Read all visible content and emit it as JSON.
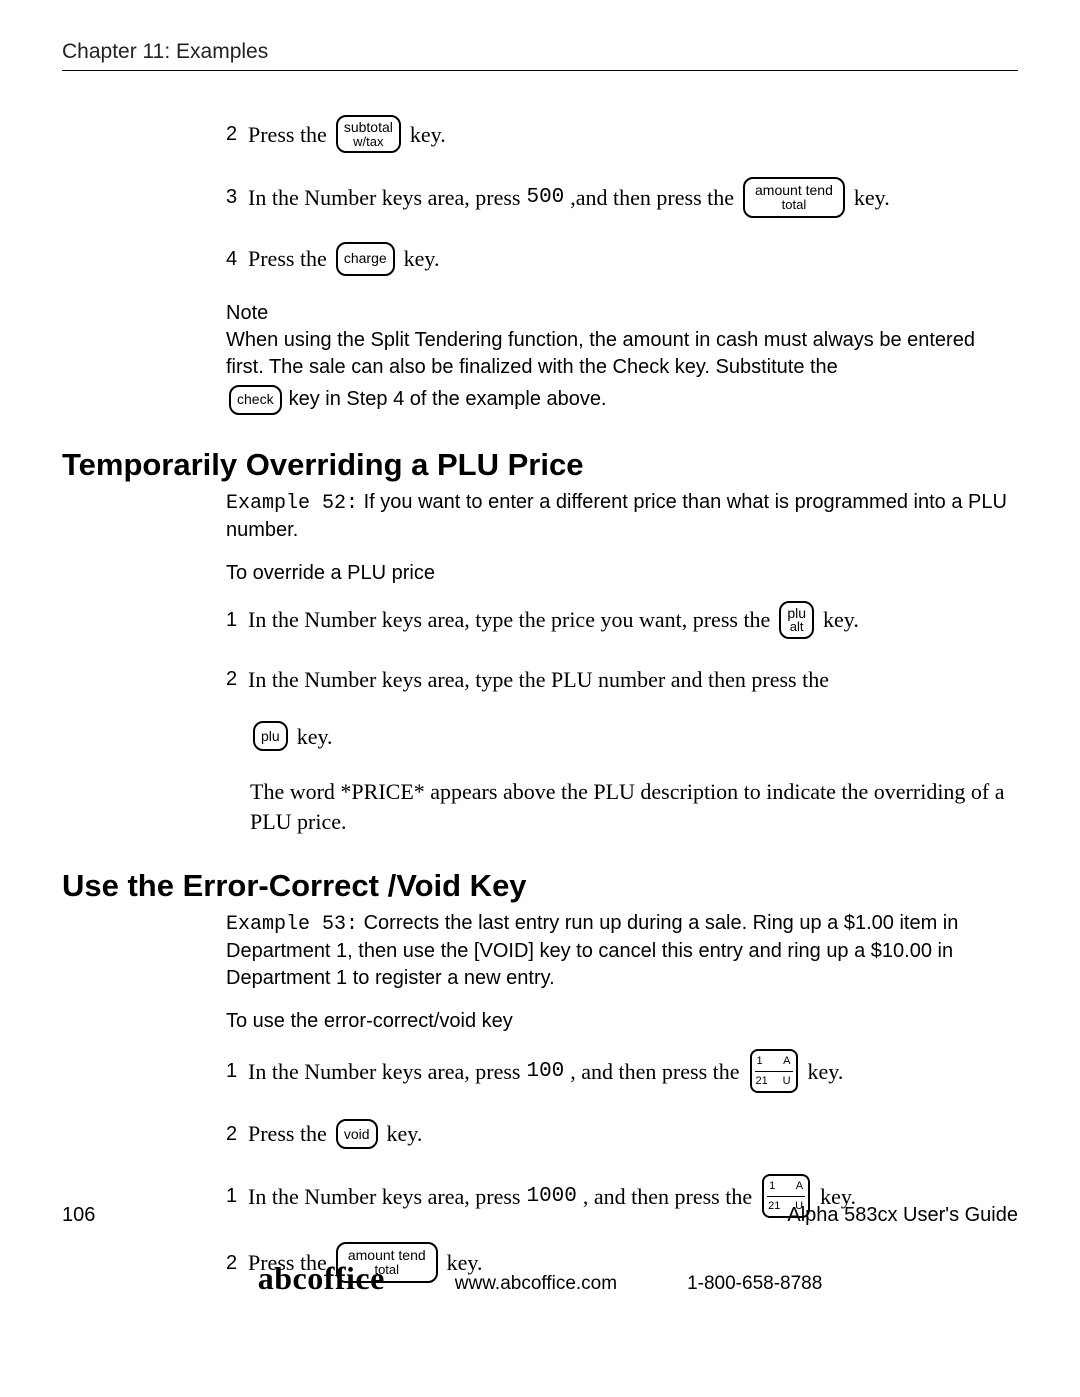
{
  "header": {
    "chapter": "Chapter 11:  Examples"
  },
  "top_steps": [
    {
      "num": "2",
      "parts": [
        {
          "t": "serif",
          "v": "Press the "
        },
        {
          "t": "key2",
          "l1": "subtotal",
          "l2": "w/tax"
        },
        {
          "t": "serif",
          "v": " key."
        }
      ]
    },
    {
      "num": "3",
      "parts": [
        {
          "t": "serif",
          "v": "In the Number keys area, press "
        },
        {
          "t": "mono",
          "v": "500"
        },
        {
          "t": "serif",
          "v": ",and then press the "
        },
        {
          "t": "keyw",
          "l1": "amount tend",
          "l2": "total"
        },
        {
          "t": "serif",
          "v": " key."
        }
      ]
    },
    {
      "num": "4",
      "parts": [
        {
          "t": "serif",
          "v": "Press the "
        },
        {
          "t": "key1",
          "l1": "charge"
        },
        {
          "t": "serif",
          "v": " key."
        }
      ]
    }
  ],
  "note": {
    "label": "Note",
    "line1": "When using the Split Tendering function, the amount in cash must always be entered first. The sale can also be finalized with the Check key. Substitute the ",
    "key": "check",
    "line2": " key in Step 4 of the example above."
  },
  "section1": {
    "heading": "Temporarily Overriding a PLU Price",
    "example_label": "Example 52:",
    "example_text": "If you want to enter a different price than what is programmed into a PLU number.",
    "subhead": "To override a PLU price",
    "steps": [
      {
        "num": "1",
        "parts": [
          {
            "t": "serif",
            "v": "In the Number keys area, type the price you want, press the "
          },
          {
            "t": "key2s",
            "l1": "plu",
            "l2": "alt"
          },
          {
            "t": "serif",
            "v": " key."
          }
        ]
      },
      {
        "num": "2",
        "parts": [
          {
            "t": "serif",
            "v": "In the Number keys area, type the PLU number and then press the"
          }
        ]
      }
    ],
    "step2_line2": {
      "parts": [
        {
          "t": "key1s",
          "l1": "plu"
        },
        {
          "t": "serif",
          "v": " key."
        }
      ]
    },
    "trailing": "The word *PRICE* appears above the PLU description to indicate the overriding of a PLU price."
  },
  "section2": {
    "heading": "Use the Error-Correct /Void Key",
    "example_label": "Example 53:",
    "example_text": "Corrects the last entry run up during a sale. Ring up a $1.00 item in Department 1, then use the [VOID] key to cancel this entry and ring up a $10.00 in Department 1 to register a new entry.",
    "subhead": "To use the error-correct/void key",
    "steps": [
      {
        "num": "1",
        "parts": [
          {
            "t": "serif",
            "v": "In the Number keys area, press "
          },
          {
            "t": "mono",
            "v": "100"
          },
          {
            "t": "serif",
            "v": ", and then press the "
          },
          {
            "t": "dept",
            "tl": "1",
            "tr": "A",
            "bl": "21",
            "br": "U"
          },
          {
            "t": "serif",
            "v": " key."
          }
        ]
      },
      {
        "num": "2",
        "parts": [
          {
            "t": "serif",
            "v": "Press the "
          },
          {
            "t": "key1s",
            "l1": "void"
          },
          {
            "t": "serif",
            "v": " key."
          }
        ]
      },
      {
        "num": "1",
        "parts": [
          {
            "t": "serif",
            "v": "In the Number keys area, press "
          },
          {
            "t": "mono",
            "v": "1000"
          },
          {
            "t": "serif",
            "v": ", and then press the "
          },
          {
            "t": "dept",
            "tl": "1",
            "tr": "A",
            "bl": "21",
            "br": "U"
          },
          {
            "t": "serif",
            "v": " key."
          }
        ]
      },
      {
        "num": "2",
        "parts": [
          {
            "t": "serif",
            "v": "Press the "
          },
          {
            "t": "keyw",
            "l1": "amount tend",
            "l2": "total"
          },
          {
            "t": "serif",
            "v": " key."
          }
        ]
      }
    ]
  },
  "footer": {
    "page": "106",
    "guide": "Alpha 583cx  User's Guide"
  },
  "brand": {
    "name": "abcoffice",
    "url": "www.abcoffice.com",
    "phone": "1-800-658-8788"
  }
}
